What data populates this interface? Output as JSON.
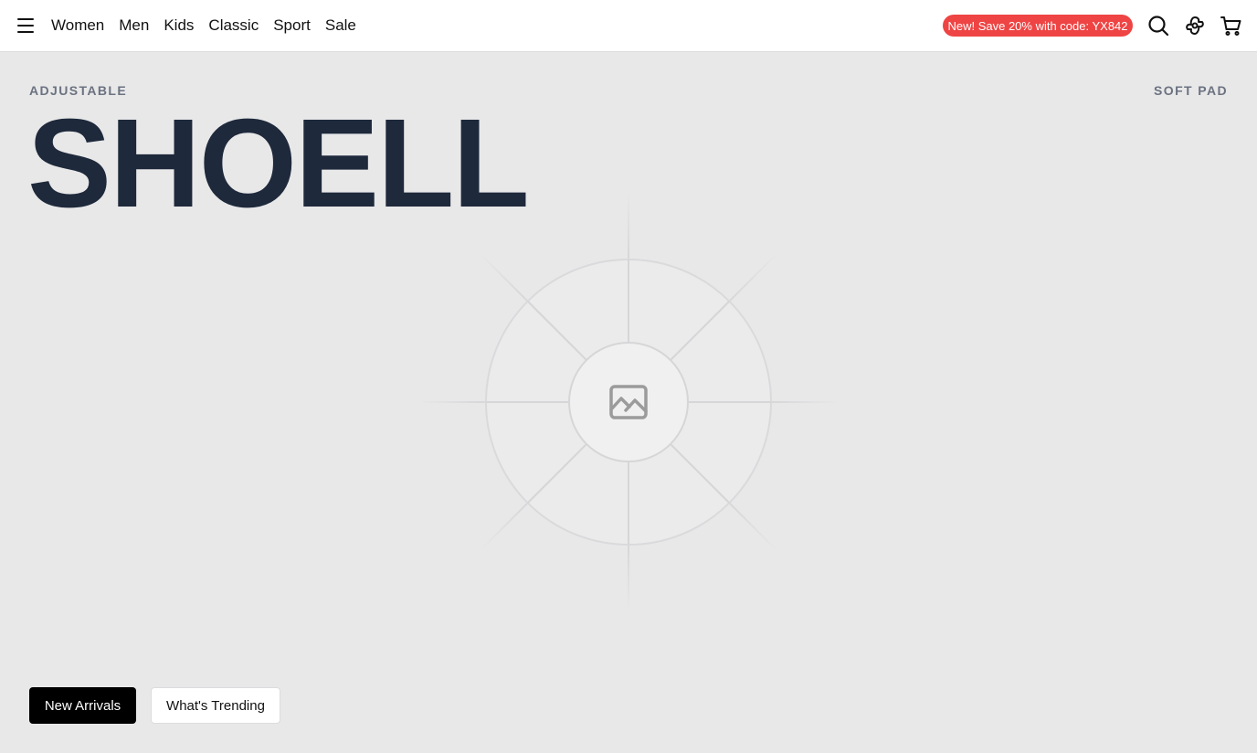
{
  "header": {
    "menu_icon": "hamburger-menu-icon",
    "nav": [
      {
        "label": "Women"
      },
      {
        "label": "Men"
      },
      {
        "label": "Kids"
      },
      {
        "label": "Classic"
      },
      {
        "label": "Sport"
      },
      {
        "label": "Sale"
      }
    ],
    "promo": "New! Save 20% with code: YX842",
    "promo_color": "#ef4444",
    "icons": [
      "search-icon",
      "brand-logo-icon",
      "cart-icon"
    ]
  },
  "hero": {
    "eyebrow_left": "ADJUSTABLE",
    "eyebrow_right": "SOFT PAD",
    "title": "SHOELL",
    "title_color": "#1e293b",
    "image_icon": "image-placeholder-icon",
    "primary_cta": "New Arrivals",
    "secondary_cta": "What's Trending"
  }
}
